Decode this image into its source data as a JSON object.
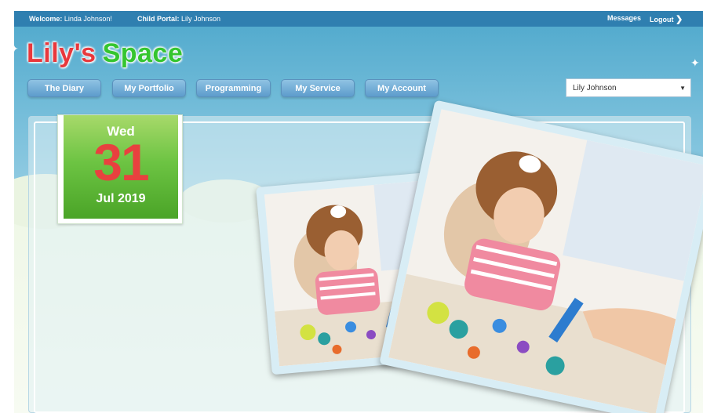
{
  "topbar": {
    "welcome_label": "Welcome:",
    "welcome_name": "Linda Johnson!",
    "child_label": "Child Portal:",
    "child_name": "Lily Johnson",
    "messages": "Messages",
    "logout": "Logout"
  },
  "logo": {
    "part1": "Lily's",
    "part2": "Space"
  },
  "nav": [
    {
      "label": "The Diary"
    },
    {
      "label": "My Portfolio"
    },
    {
      "label": "Programming"
    },
    {
      "label": "My Service"
    },
    {
      "label": "My Account"
    }
  ],
  "child_select": {
    "value": "Lily Johnson"
  },
  "date": {
    "weekday": "Wed",
    "day": "31",
    "month_year": "Jul 2019"
  },
  "colors": {
    "logo_red": "#e8383c",
    "logo_green": "#35c52f",
    "topbar": "#2f7fb0",
    "date_green": "#6dc443"
  }
}
